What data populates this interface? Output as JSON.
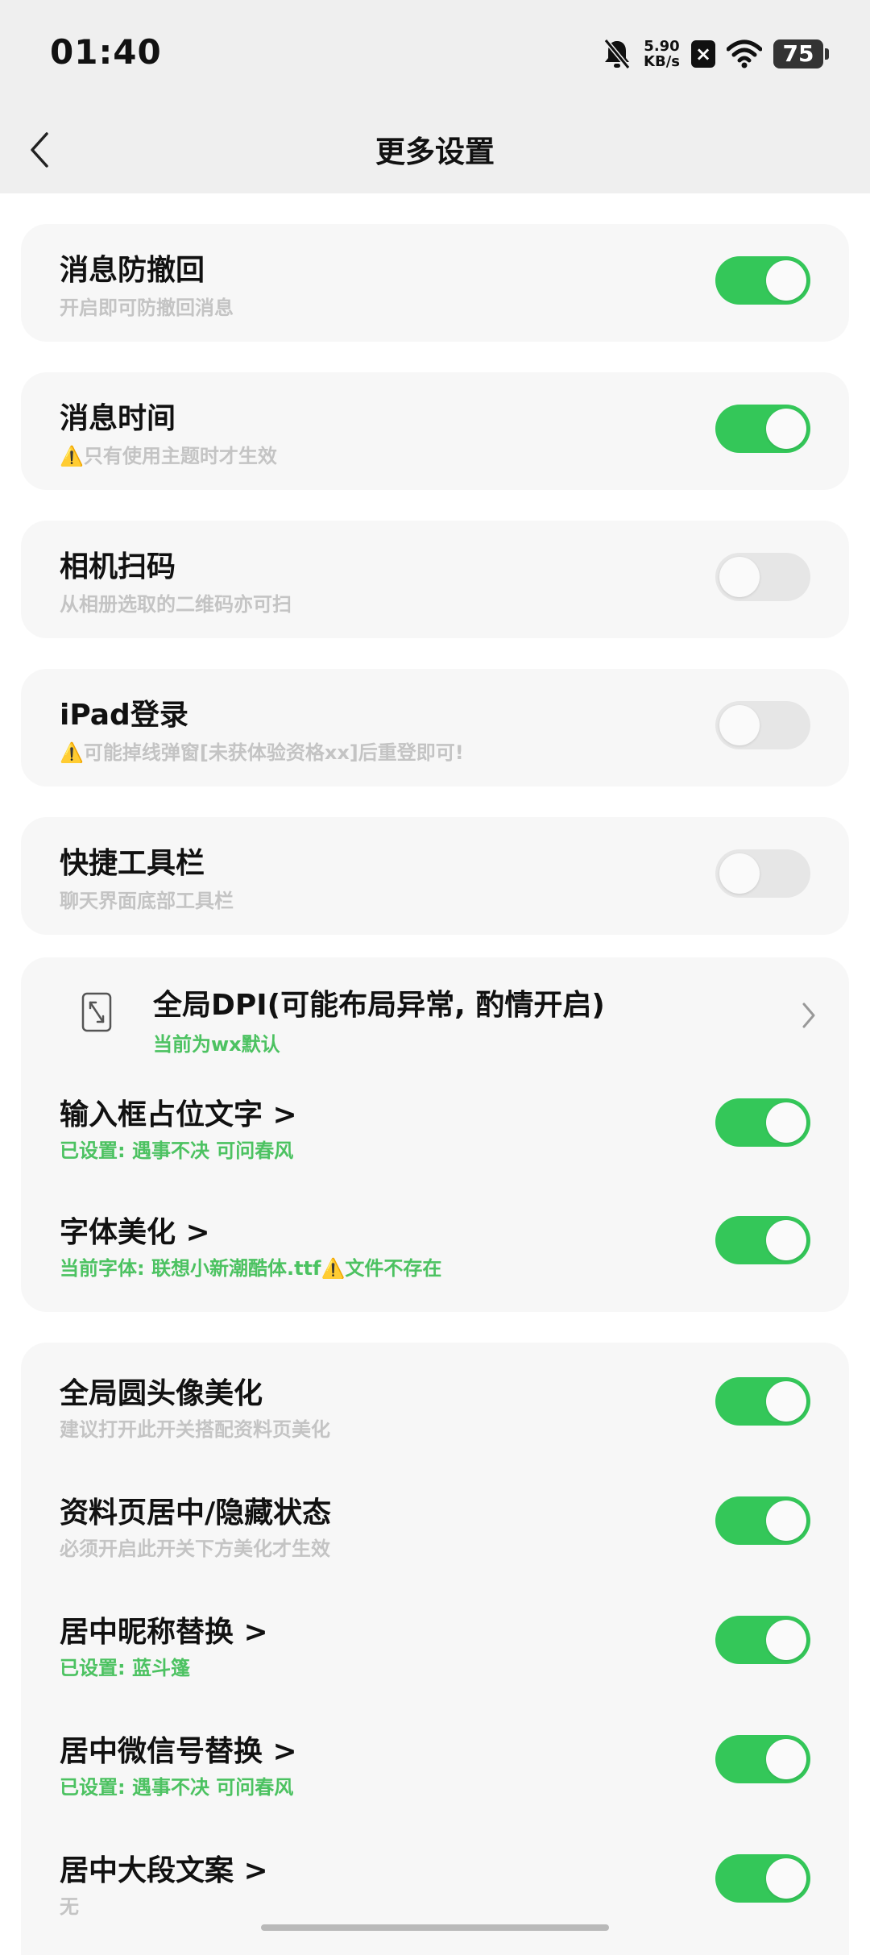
{
  "status_bar": {
    "time": "01:40",
    "net_speed_value": "5.90",
    "net_speed_unit": "KB/s",
    "x_badge": "×",
    "battery": "75",
    "icons": [
      "bell-mute-icon",
      "x-app-icon",
      "wifi-icon",
      "battery-icon"
    ]
  },
  "nav": {
    "title": "更多设置",
    "back_icon": "chevron-left-icon"
  },
  "settings": [
    {
      "title": "消息防撤回",
      "subtitle": "开启即可防撤回消息",
      "on": true
    },
    {
      "title": "消息时间",
      "subtitle": "⚠️只有使用主题时才生效",
      "on": true
    },
    {
      "title": "相机扫码",
      "subtitle": "从相册选取的二维码亦可扫",
      "on": false
    },
    {
      "title": "iPad登录",
      "subtitle": "⚠️可能掉线弹窗[未获体验资格xx]后重登即可!",
      "on": false
    },
    {
      "title": "快捷工具栏",
      "subtitle": "聊天界面底部工具栏",
      "on": false
    }
  ],
  "display_group": {
    "dpi": {
      "title": "全局DPI(可能布局异常, 酌情开启)",
      "subtitle": "当前为wx默认",
      "icon": "resize-icon"
    },
    "placeholder": {
      "title": "输入框占位文字 >",
      "subtitle": "已设置: 遇事不决  可问春风",
      "on": true
    },
    "font": {
      "title": "字体美化 >",
      "subtitle": "当前字体: 联想小新潮酷体.ttf⚠️文件不存在",
      "on": true
    }
  },
  "avatar_group": [
    {
      "title": "全局圆头像美化",
      "subtitle": "建议打开此开关搭配资料页美化",
      "on": true,
      "green": false
    },
    {
      "title": "资料页居中/隐藏状态",
      "subtitle": "必须开启此开关下方美化才生效",
      "on": true,
      "green": false
    },
    {
      "title": "居中昵称替换 >",
      "subtitle": "已设置: 蓝斗篷",
      "on": true,
      "green": true
    },
    {
      "title": "居中微信号替换 >",
      "subtitle": "已设置: 遇事不决 可问春风",
      "on": true,
      "green": true
    },
    {
      "title": "居中大段文案 >",
      "subtitle": "无",
      "on": true,
      "green": false
    }
  ],
  "colors": {
    "accent": "#34c759",
    "green_text": "#4cc261",
    "card_bg": "#f7f7f7"
  }
}
